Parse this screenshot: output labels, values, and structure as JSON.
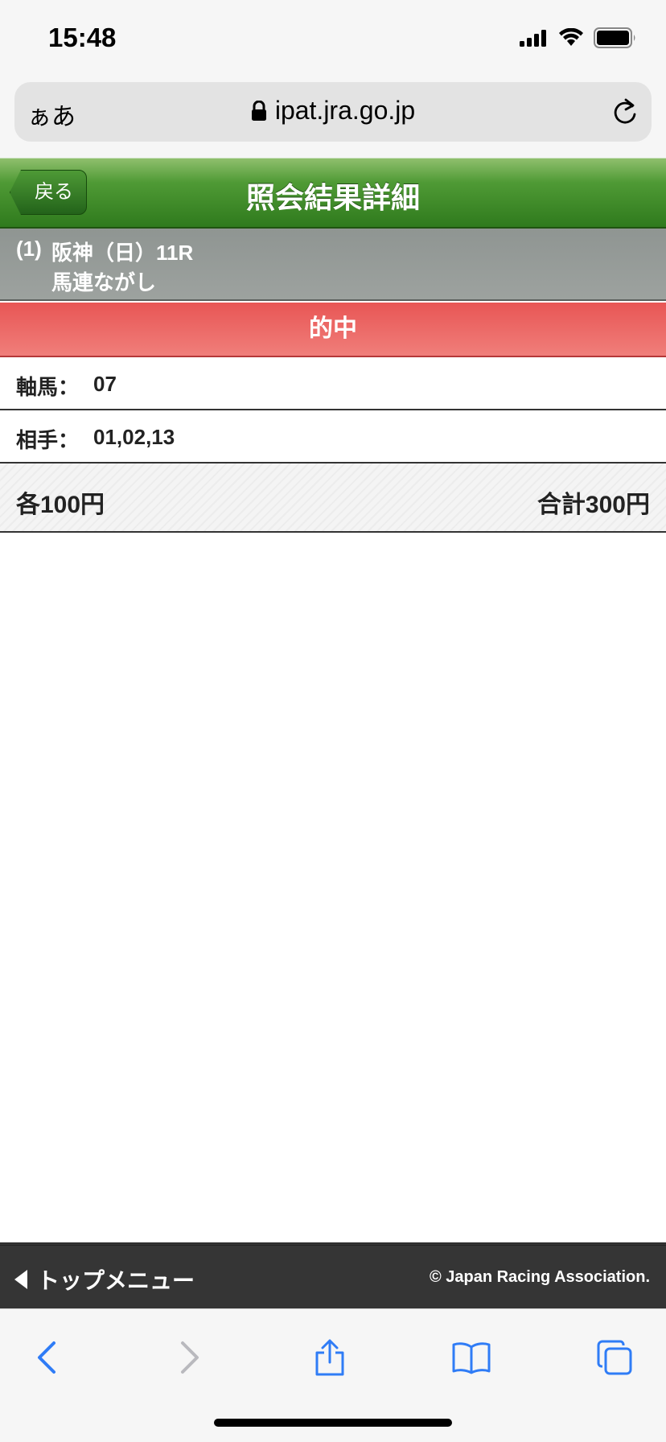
{
  "status_bar": {
    "time": "15:48"
  },
  "browser": {
    "aa_label": "ぁあ",
    "url": "ipat.jra.go.jp"
  },
  "header": {
    "back_label": "戻る",
    "title": "照会結果詳細"
  },
  "race": {
    "number": "(1)",
    "venue": "阪神（日）11R",
    "bet_type": "馬連ながし"
  },
  "result": {
    "status": "的中"
  },
  "details": [
    {
      "label": "軸馬：",
      "value": "07"
    },
    {
      "label": "相手：",
      "value": "01,02,13"
    }
  ],
  "amount": {
    "unit": "各100円",
    "total": "合計300円"
  },
  "footer": {
    "top_menu": "トップメニュー",
    "copyright": "© Japan Racing Association."
  },
  "colors": {
    "header_green": "#2f7a1d",
    "hit_red": "#e85655",
    "footer_dark": "#353535",
    "ios_blue": "#2f7cf6"
  },
  "icons": [
    "signal-icon",
    "wifi-icon",
    "battery-icon",
    "lock-icon",
    "reload-icon",
    "back-icon",
    "forward-icon",
    "share-icon",
    "bookmarks-icon",
    "tabs-icon"
  ]
}
